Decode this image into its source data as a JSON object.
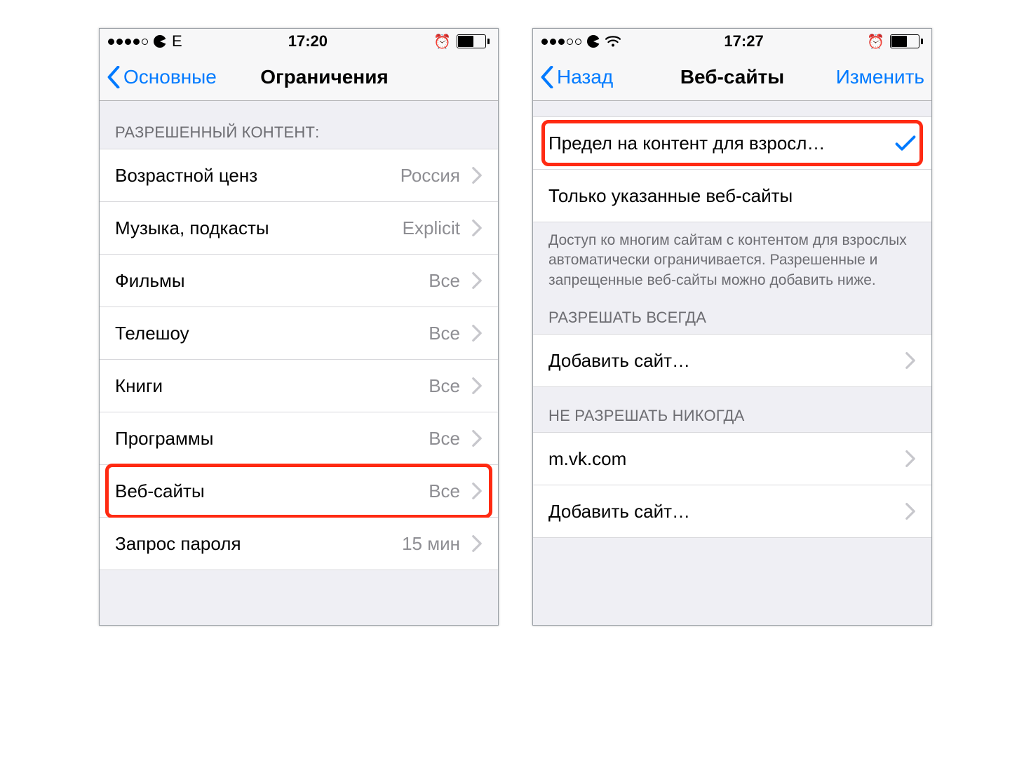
{
  "left": {
    "status": {
      "carrier": "E",
      "time": "17:20"
    },
    "nav": {
      "back": "Основные",
      "title": "Ограничения"
    },
    "section_header": "РАЗРЕШЕННЫЙ КОНТЕНТ:",
    "rows": {
      "r0": {
        "label": "Возрастной ценз",
        "value": "Россия"
      },
      "r1": {
        "label": "Музыка, подкасты",
        "value": "Explicit"
      },
      "r2": {
        "label": "Фильмы",
        "value": "Все"
      },
      "r3": {
        "label": "Телешоу",
        "value": "Все"
      },
      "r4": {
        "label": "Книги",
        "value": "Все"
      },
      "r5": {
        "label": "Программы",
        "value": "Все"
      },
      "r6": {
        "label": "Веб-сайты",
        "value": "Все"
      },
      "r7": {
        "label": "Запрос пароля",
        "value": "15 мин"
      }
    }
  },
  "right": {
    "status": {
      "time": "17:27"
    },
    "nav": {
      "back": "Назад",
      "title": "Веб-сайты",
      "edit": "Изменить"
    },
    "option1": "Предел на контент для взросл…",
    "option2": "Только указанные веб-сайты",
    "footer": "Доступ ко многим сайтам с контентом для взрослых автоматически ограничивается. Разрешенные и запрещенные веб-сайты можно добавить ниже.",
    "allow_header": "РАЗРЕШАТЬ ВСЕГДА",
    "allow_add": "Добавить сайт…",
    "deny_header": "НЕ РАЗРЕШАТЬ НИКОГДА",
    "deny_site": "m.vk.com",
    "deny_add": "Добавить сайт…"
  }
}
